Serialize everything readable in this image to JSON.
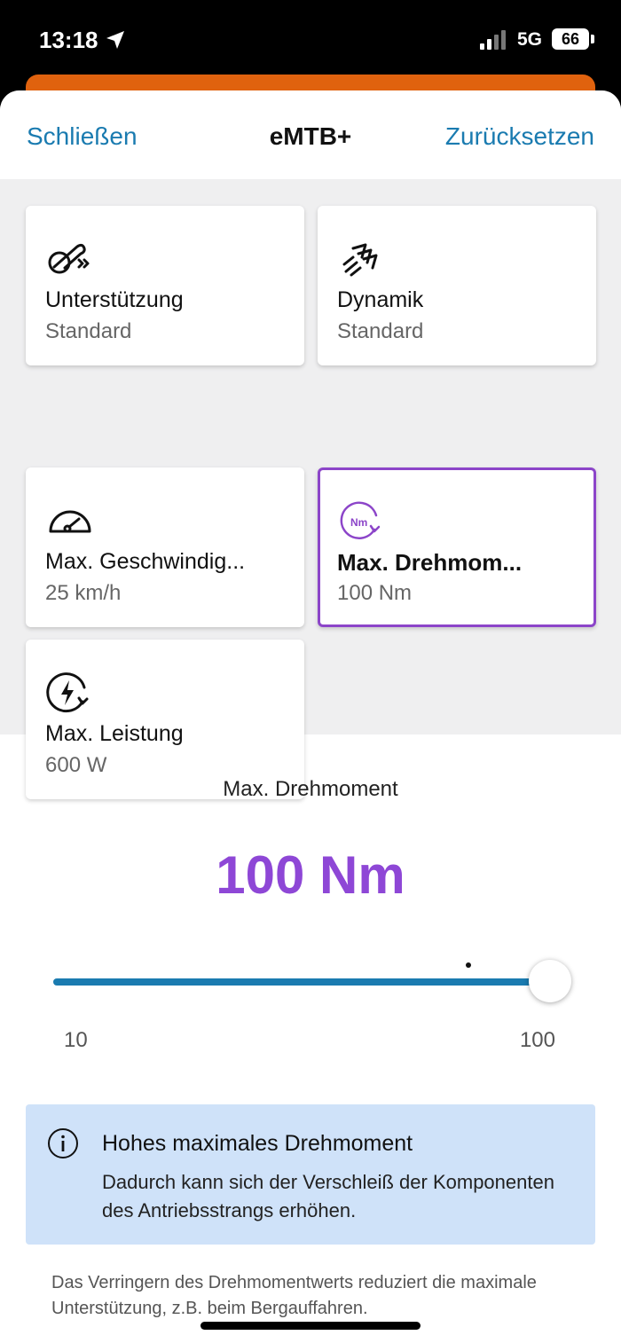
{
  "status_bar": {
    "time": "13:18",
    "network": "5G",
    "battery": "66"
  },
  "header": {
    "close_label": "Schließen",
    "title": "eMTB+",
    "reset_label": "Zurücksetzen"
  },
  "tiles": [
    {
      "title": "Unterstützung",
      "value": "Standard",
      "icon": "assist-icon"
    },
    {
      "title": "Dynamik",
      "value": "Standard",
      "icon": "dynamics-icon"
    },
    {
      "title": "Max. Geschwindig...",
      "value": "25 km/h",
      "icon": "speedometer-icon"
    },
    {
      "title": "Max. Drehmom...",
      "value": "100 Nm",
      "icon": "torque-icon",
      "selected": true
    },
    {
      "title": "Max. Leistung",
      "value": "600 W",
      "icon": "power-icon"
    }
  ],
  "detail": {
    "label": "Max. Drehmoment",
    "value": "100 Nm",
    "slider": {
      "min_label": "10",
      "max_label": "100",
      "min": 10,
      "max": 100,
      "value": 100
    }
  },
  "info": {
    "title": "Hohes maximales Drehmoment",
    "text": "Dadurch kann sich der Verschleiß der Komponenten des Antriebsstrangs erhöhen."
  },
  "footnote": "Das Verringern des Drehmomentwerts reduziert die maximale Unterstützung, z.B. beim Bergauffahren.",
  "colors": {
    "accent_link": "#1a7bb0",
    "selection": "#8c45c9",
    "value_purple": "#8e47d6",
    "info_background": "#cfe2f9",
    "underlay_orange": "#e0620e"
  }
}
